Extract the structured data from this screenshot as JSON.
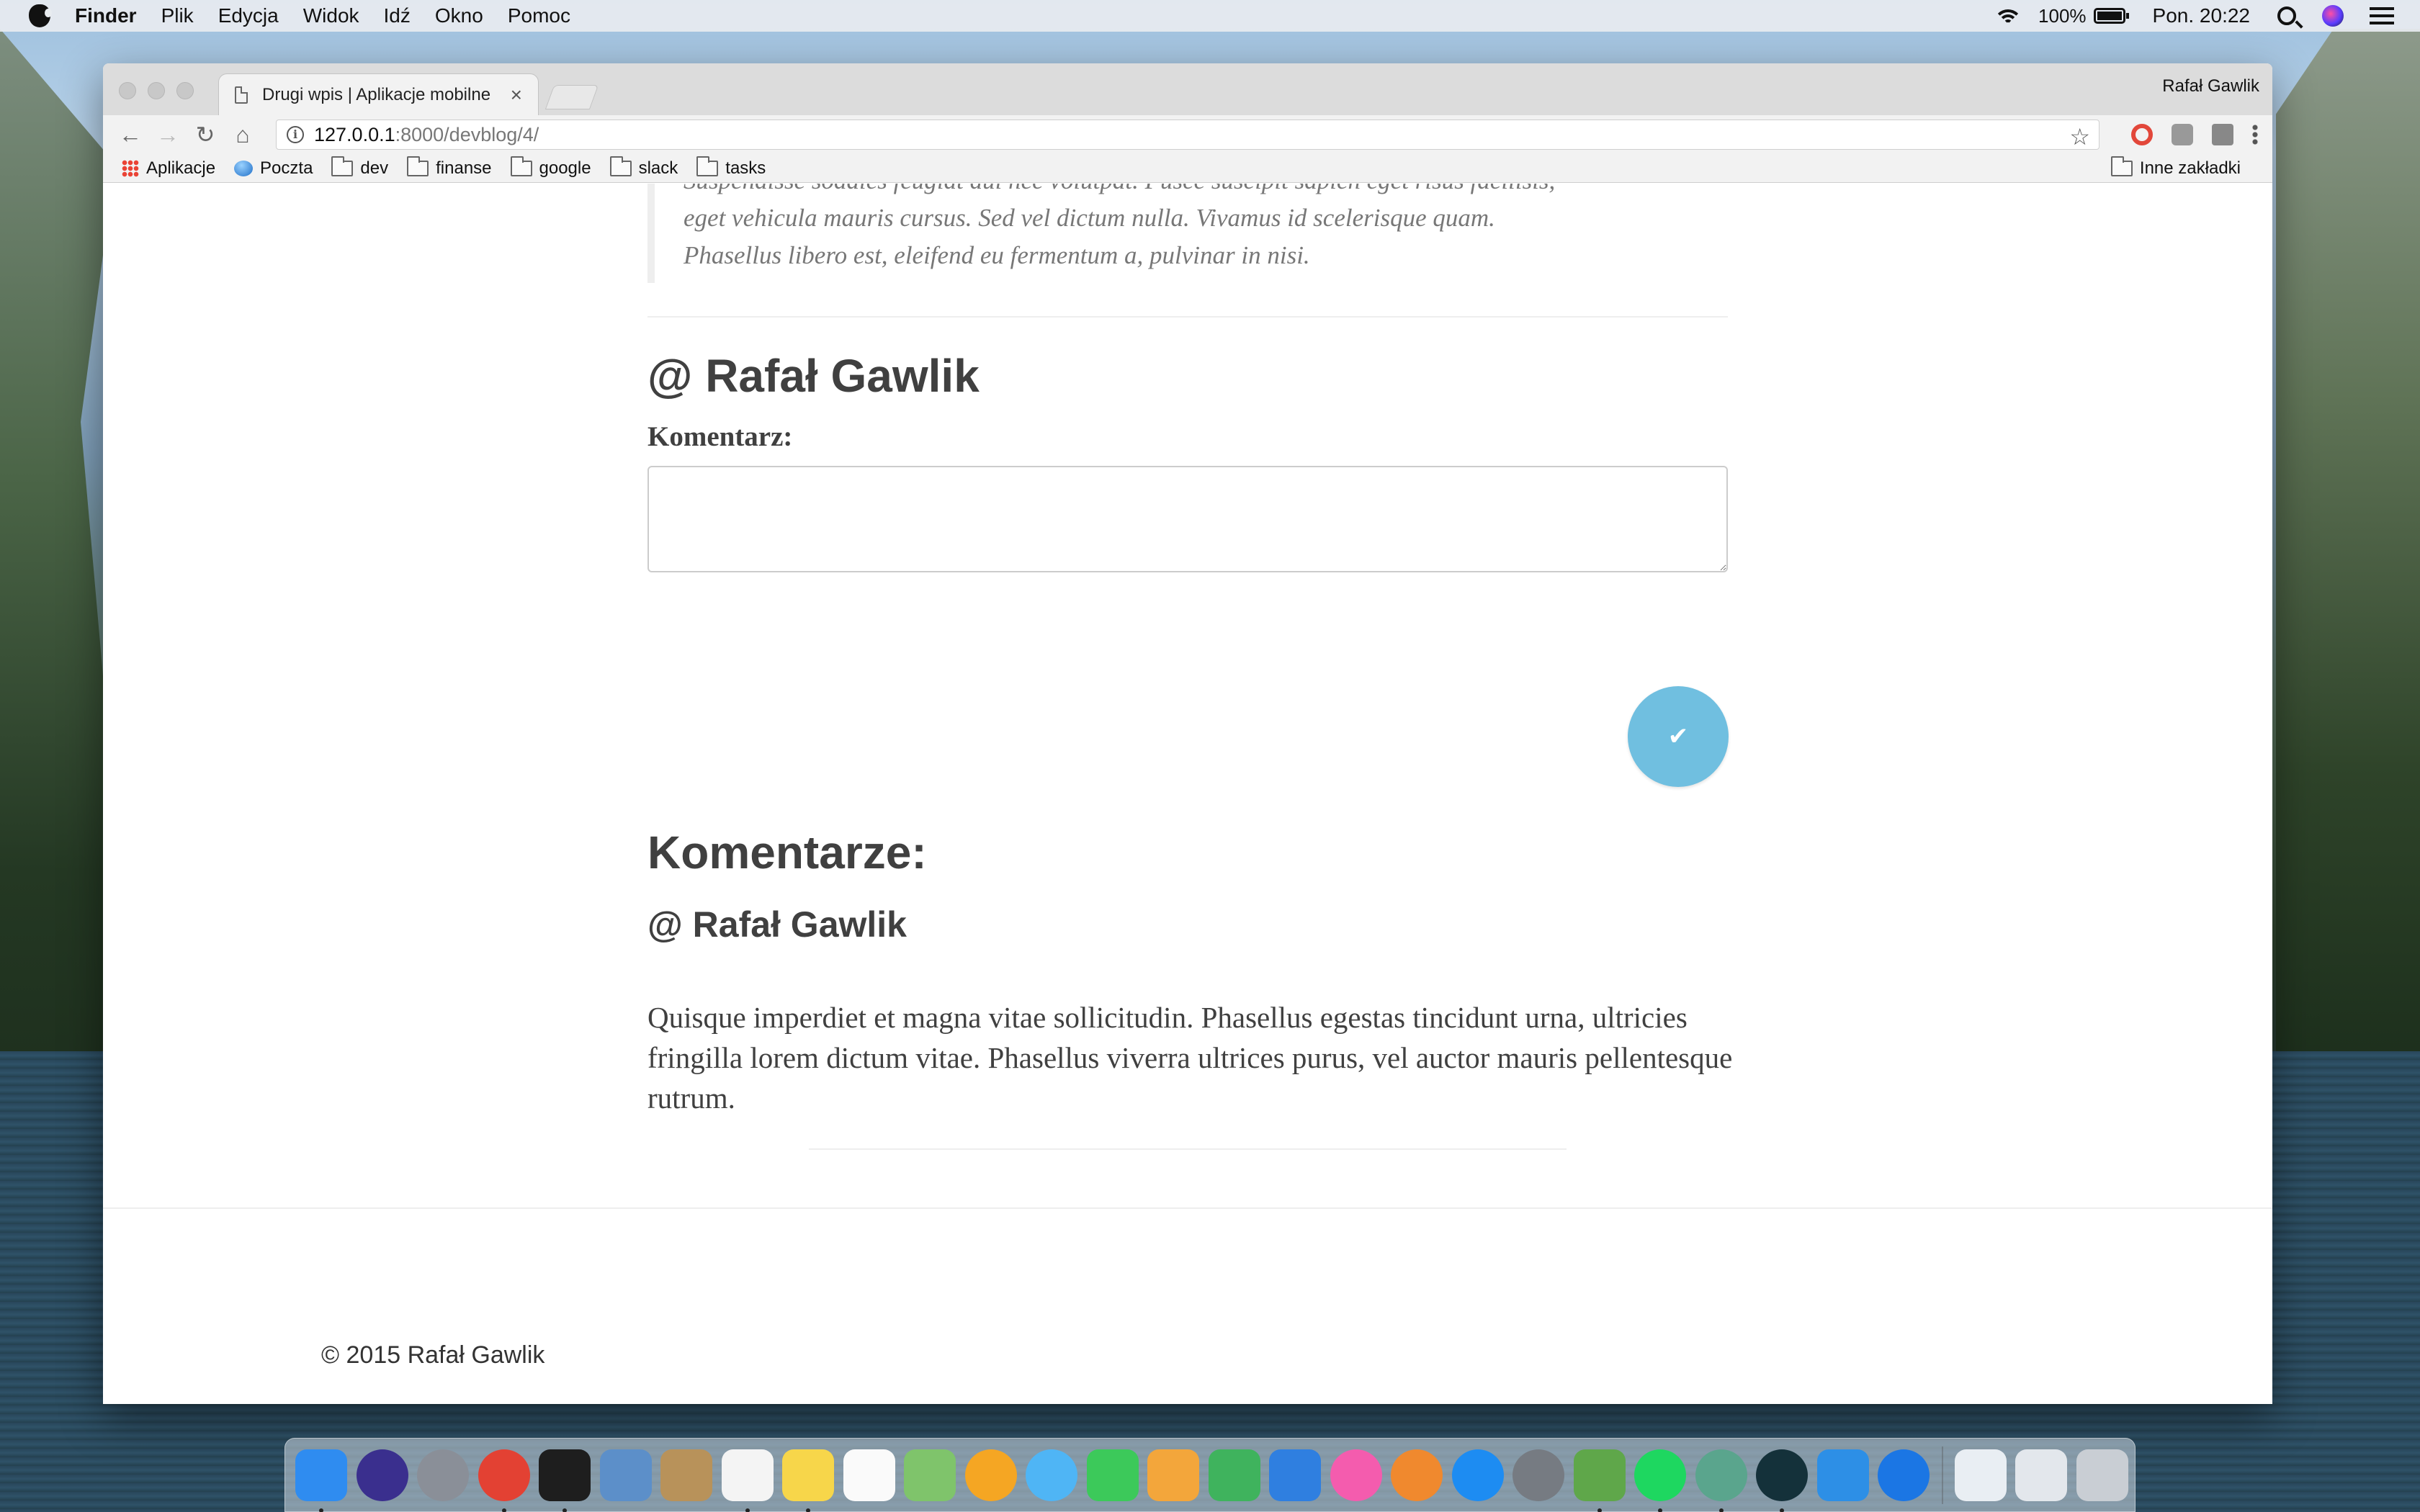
{
  "menubar": {
    "app_name": "Finder",
    "items": [
      "Plik",
      "Edycja",
      "Widok",
      "Idź",
      "Okno",
      "Pomoc"
    ],
    "battery": "100%",
    "clock": "Pon. 20:22"
  },
  "browser": {
    "tab_title": "Drugi wpis | Aplikacje mobilne",
    "tab_close": "×",
    "profile_name": "Rafał Gawlik",
    "url_host": "127.0.0.1",
    "url_path": ":8000/devblog/4/",
    "bookmarks": {
      "apps": "Aplikacje",
      "mail": "Poczta",
      "folders": [
        "dev",
        "finanse",
        "google",
        "slack",
        "tasks"
      ],
      "other": "Inne zakładki"
    }
  },
  "page": {
    "quote_lines": [
      "Suspendisse sodales feugiat dui nec volutpat. Fusce suscipit sapien eget risus facilisis,",
      "eget vehicula mauris cursus. Sed vel dictum nulla. Vivamus id scelerisque quam.",
      "Phasellus libero est, eleifend eu fermentum a, pulvinar in nisi."
    ],
    "user_heading": "@ Rafał Gawlik",
    "comment_label": "Komentarz:",
    "comment_value": "",
    "submit_icon": "check-icon",
    "comments_heading": "Komentarze:",
    "comments": [
      {
        "author": "@ Rafał Gawlik",
        "text": "Quisque imperdiet et magna vitae sollicitudin. Phasellus egestas tincidunt urna, ultricies fringilla lorem dictum vitae. Phasellus viverra ultrices purus, vel auctor mauris pellentesque rutrum."
      }
    ],
    "copyright": "© 2015 Rafał Gawlik"
  },
  "colors": {
    "submit_button": "#70bfe0",
    "heading_text": "#404040",
    "quote_text": "#777777"
  },
  "dock": {
    "apps": [
      {
        "name": "finder-icon",
        "color": "#2f8cf0",
        "running": true
      },
      {
        "name": "siri-icon",
        "color": "#3a2f8e",
        "running": false
      },
      {
        "name": "launchpad-icon",
        "color": "#8a8f98",
        "running": false
      },
      {
        "name": "chrome-icon",
        "color": "#e34133",
        "running": true
      },
      {
        "name": "terminal-icon",
        "color": "#1e1e1e",
        "running": true
      },
      {
        "name": "preview-icon",
        "color": "#5c8fc9",
        "running": false
      },
      {
        "name": "contacts-icon",
        "color": "#b8925a",
        "running": false
      },
      {
        "name": "calendar-icon",
        "color": "#f4f4f4",
        "running": true
      },
      {
        "name": "notes-icon",
        "color": "#f7d64a",
        "running": true
      },
      {
        "name": "reminders-icon",
        "color": "#fafafa",
        "running": false
      },
      {
        "name": "maps-icon",
        "color": "#7fc46b",
        "running": false
      },
      {
        "name": "photos-icon",
        "color": "#f5a623",
        "running": false
      },
      {
        "name": "messages-icon",
        "color": "#4fb5f5",
        "running": false
      },
      {
        "name": "facetime-icon",
        "color": "#3cc95a",
        "running": false
      },
      {
        "name": "pages-icon",
        "color": "#f3a63b",
        "running": false
      },
      {
        "name": "numbers-icon",
        "color": "#3fb35d",
        "running": false
      },
      {
        "name": "keynote-icon",
        "color": "#2f7fe0",
        "running": false
      },
      {
        "name": "itunes-icon",
        "color": "#f45cae",
        "running": false
      },
      {
        "name": "ibooks-icon",
        "color": "#f0892e",
        "running": false
      },
      {
        "name": "app-store-icon",
        "color": "#1d8cf2",
        "running": false
      },
      {
        "name": "system-preferences-icon",
        "color": "#767b82",
        "running": false
      },
      {
        "name": "android-studio-icon",
        "color": "#5fa74a",
        "running": true
      },
      {
        "name": "spotify-icon",
        "color": "#1ed760",
        "running": true
      },
      {
        "name": "atom-icon",
        "color": "#5aa58d",
        "running": true
      },
      {
        "name": "gitkraken-icon",
        "color": "#14313a",
        "running": true
      },
      {
        "name": "xcode-icon",
        "color": "#2d8fe6",
        "running": false
      },
      {
        "name": "maps-pin-icon",
        "color": "#1b76e4",
        "running": false
      }
    ],
    "stacks": [
      {
        "name": "downloads-stack-icon",
        "color": "#e9eef3"
      },
      {
        "name": "documents-stack-icon",
        "color": "#e3e7ec"
      },
      {
        "name": "trash-icon",
        "color": "#c9ced4"
      }
    ]
  }
}
